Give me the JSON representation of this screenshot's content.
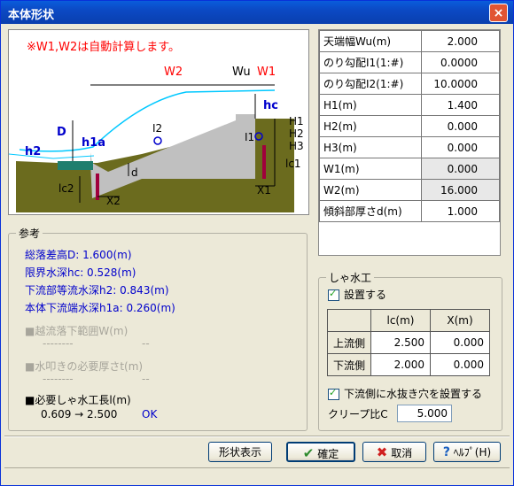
{
  "window": {
    "title": "本体形状",
    "close_label": "×"
  },
  "diagram": {
    "note": "※W1,W2は自動計算します。",
    "labels": {
      "W2": "W2",
      "Wu": "Wu",
      "W1": "W1",
      "hc": "hc",
      "D": "D",
      "h1a": "h1a",
      "h2": "h2",
      "I2": "I2",
      "I1": "I1",
      "H1": "H1",
      "H2": "H2",
      "H3": "H3",
      "lc1": "lc1",
      "lc2": "lc2",
      "d": "d",
      "X1": "X1",
      "X2": "X2"
    }
  },
  "params": [
    {
      "label": "天端幅Wu(m)",
      "value": "2.000",
      "readonly": false
    },
    {
      "label": "のり勾配I1(1:#)",
      "value": "0.0000",
      "readonly": false
    },
    {
      "label": "のり勾配I2(1:#)",
      "value": "10.0000",
      "readonly": false
    },
    {
      "label": "H1(m)",
      "value": "1.400",
      "readonly": false
    },
    {
      "label": "H2(m)",
      "value": "0.000",
      "readonly": false
    },
    {
      "label": "H3(m)",
      "value": "0.000",
      "readonly": false
    },
    {
      "label": "W1(m)",
      "value": "0.000",
      "readonly": true
    },
    {
      "label": "W2(m)",
      "value": "16.000",
      "readonly": true
    },
    {
      "label": "傾斜部厚さd(m)",
      "value": "1.000",
      "readonly": false
    }
  ],
  "reference": {
    "title": "参考",
    "lines": [
      "総落差高D: 1.600(m)",
      "限界水深hc: 0.528(m)",
      "下流部等流水深h2: 0.843(m)",
      "本体下流端水深h1a: 0.260(m)"
    ],
    "overflow_range": {
      "label": "■越流落下範囲W(m)",
      "dashes": "--------",
      "dash2": "--"
    },
    "apron_thickness": {
      "label": "■水叩きの必要厚さt(m)",
      "dashes": "--------",
      "dash2": "--"
    },
    "cutoff_length": {
      "label": "■必要しゃ水工長l(m)",
      "value": "0.609 → 2.500",
      "status": "OK"
    }
  },
  "cutoff": {
    "title": "しゃ水工",
    "setup_label": "設置する",
    "col_lc": "lc(m)",
    "col_x": "X(m)",
    "rows": [
      {
        "label": "上流側",
        "lc": "2.500",
        "x": "0.000"
      },
      {
        "label": "下流側",
        "lc": "2.000",
        "x": "0.000"
      }
    ],
    "drain_label": "下流側に水抜き穴を設置する",
    "creep_label": "クリープ比C",
    "creep_value": "5.000"
  },
  "buttons": {
    "shape": "形状表示",
    "ok": "確定",
    "cancel": "取消",
    "help": "ﾍﾙﾌﾟ(H)"
  },
  "colors": {
    "note": "#ff0000",
    "ref_text": "#0000cc",
    "water": "#00c8ff",
    "ground": "#6b6b1e"
  }
}
